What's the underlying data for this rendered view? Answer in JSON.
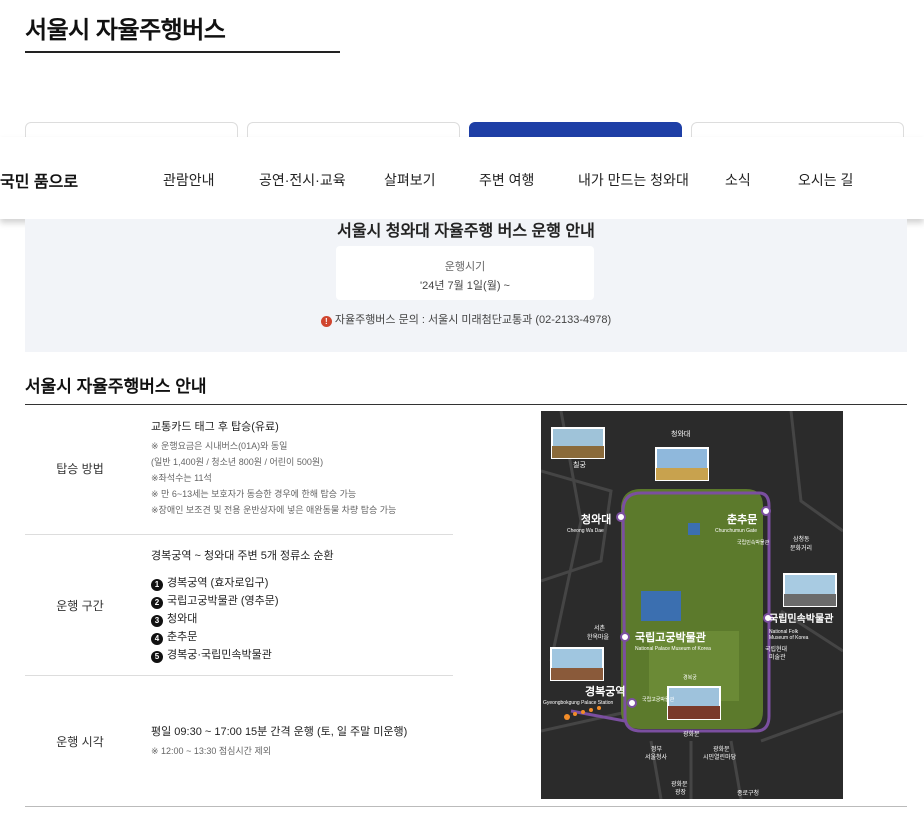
{
  "page_title": "서울시 자율주행버스",
  "gnb": {
    "logo": "국민 품으로",
    "items": [
      "관람안내",
      "공연·전시·교육",
      "살펴보기",
      "주변 여행",
      "내가 만드는 청와대",
      "소식",
      "오시는 길"
    ]
  },
  "notice": {
    "title": "서울시 청와대 자율주행 버스 운행 안내",
    "period_label": "운행시기",
    "period_value": "'24년 7월 1일(월) ~",
    "contact": "자율주행버스 문의 : 서울시 미래첨단교통과 (02-2133-4978)",
    "icon": "alert-icon"
  },
  "section_title": "서울시 자율주행버스 안내",
  "rows": {
    "boarding": {
      "label": "탑승 방법",
      "head": "교통카드 태그 후 탑승(유료)",
      "notes": [
        "※ 운행요금은 시내버스(01A)와 동일",
        "(일반 1,400원 / 청소년 800원 / 어린이 500원)",
        "※좌석수는 11석",
        "※ 만 6~13세는 보호자가 동승한 경우에 한해 탑승 가능",
        "※장애인 보조견 및 전용 운반상자에 넣은 애완동물 차량 탑승 가능"
      ]
    },
    "route": {
      "label": "운행 구간",
      "head": "경복궁역 ~ 청와대 주변 5개 정류소 순환",
      "stops": [
        {
          "num": "1",
          "name": "경복궁역 (효자로입구)"
        },
        {
          "num": "2",
          "name": "국립고궁박물관 (영추문)"
        },
        {
          "num": "3",
          "name": "청와대"
        },
        {
          "num": "4",
          "name": "춘추문"
        },
        {
          "num": "5",
          "name": "경복궁·국립민속박물관"
        }
      ]
    },
    "hours": {
      "label": "운행 시각",
      "head": "평일 09:30 ~ 17:00 15분 간격 운행 (토, 일 주말 미운행)",
      "note": "※ 12:00 ~ 13:30 점심시간 제외"
    }
  },
  "map": {
    "colors": {
      "background": "#2b2b2b",
      "park": "#5c7a2c",
      "route": "#7b4fa0",
      "pond": "#3b6fb0"
    },
    "labels": {
      "cheongwadae_top": "청와대",
      "chilgung": "칠궁",
      "cheongwadae": "청와대",
      "cheongwadae_en": "Cheong Wa Dae",
      "chunchumun": "춘추문",
      "chunchumun_en": "Chunchumun Gate",
      "samcheong": "삼청동",
      "samcheong2": "문화거리",
      "folk": "국립민속박물관",
      "folk_en1": "National Folk",
      "folk_en2": "Museum of Korea",
      "gogung": "국립고궁박물관",
      "gogung_en": "National Palace Museum of Korea",
      "seochon": "서촌",
      "seochon2": "한옥마을",
      "mmca": "국립현대",
      "mmca2": "미술관",
      "gyeongbokgung_station": "경복궁역",
      "gyeongbokgung_station_en": "Gyeongbokgung Palace Station",
      "gwanghwamun": "광화문",
      "jeongbu": "정부",
      "jeongbu2": "서울청사",
      "gwanghwamun2": "광화문",
      "gwanghwamun3": "시민열린마당",
      "plaza": "광화문",
      "plaza2": "광장",
      "jongno": "종로구청",
      "gyeongbok_mini": "경복궁",
      "folk_mini": "국립민속박물관",
      "gogung_mini": "국립고궁박물관"
    }
  }
}
